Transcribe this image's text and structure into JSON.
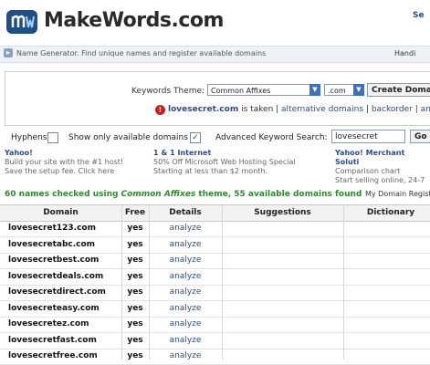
{
  "header": {
    "brand": "MakeWords.com",
    "right_text": "Se"
  },
  "tagbar": {
    "text": "Name Generator. Find unique names and register available domains",
    "right_text": "Handi"
  },
  "search": {
    "keywords_label": "Keywords Theme:",
    "theme_value": "Common Affixes",
    "tld_value": ".com",
    "create_label": "Create Doma",
    "taken": {
      "domain": "lovesecret.com",
      "is_taken": " is taken | ",
      "alt_link": "alternative domains",
      "sep1": " | ",
      "backorder_link": "backorder",
      "sep2": " | ",
      "more_link": "an"
    }
  },
  "options": {
    "hyphens_label": "Hyphens",
    "avail_label": "Show only available domains",
    "avail_checked_glyph": "✓",
    "adv_label": "Advanced Keyword Search:",
    "adv_value": "lovesecret",
    "go_label": "Go"
  },
  "ads": [
    {
      "title": "Yahoo!",
      "line1": "Build your site with the #1 host!",
      "line2": "Save the setup fee. Click here"
    },
    {
      "title": "1 & 1 Internet",
      "line1": "50% Off Microsoft Web Hosting Special",
      "line2": "Starting at less than $2 month."
    },
    {
      "title": "Yahoo! Merchant Soluti",
      "line1": "Comparison chart",
      "line2": "Start selling online, 24-7"
    }
  ],
  "results": {
    "prefix": "60 names checked using ",
    "theme": "Common Affixes",
    "suffix": " theme, 55 available domains found",
    "registrar_label": "My Domain Regist"
  },
  "table": {
    "headers": [
      "Domain",
      "Free",
      "Details",
      "Suggestions",
      "Dictionary"
    ],
    "rows": [
      {
        "domain": "lovesecret123.com",
        "free": "yes",
        "details": "analyze"
      },
      {
        "domain": "lovesecretabc.com",
        "free": "yes",
        "details": "analyze"
      },
      {
        "domain": "lovesecretbest.com",
        "free": "yes",
        "details": "analyze"
      },
      {
        "domain": "lovesecretdeals.com",
        "free": "yes",
        "details": "analyze"
      },
      {
        "domain": "lovesecretdirect.com",
        "free": "yes",
        "details": "analyze"
      },
      {
        "domain": "lovesecreteasy.com",
        "free": "yes",
        "details": "analyze"
      },
      {
        "domain": "lovesecretez.com",
        "free": "yes",
        "details": "analyze"
      },
      {
        "domain": "lovesecretfast.com",
        "free": "yes",
        "details": "analyze"
      },
      {
        "domain": "lovesecretfree.com",
        "free": "yes",
        "details": "analyze"
      }
    ]
  }
}
